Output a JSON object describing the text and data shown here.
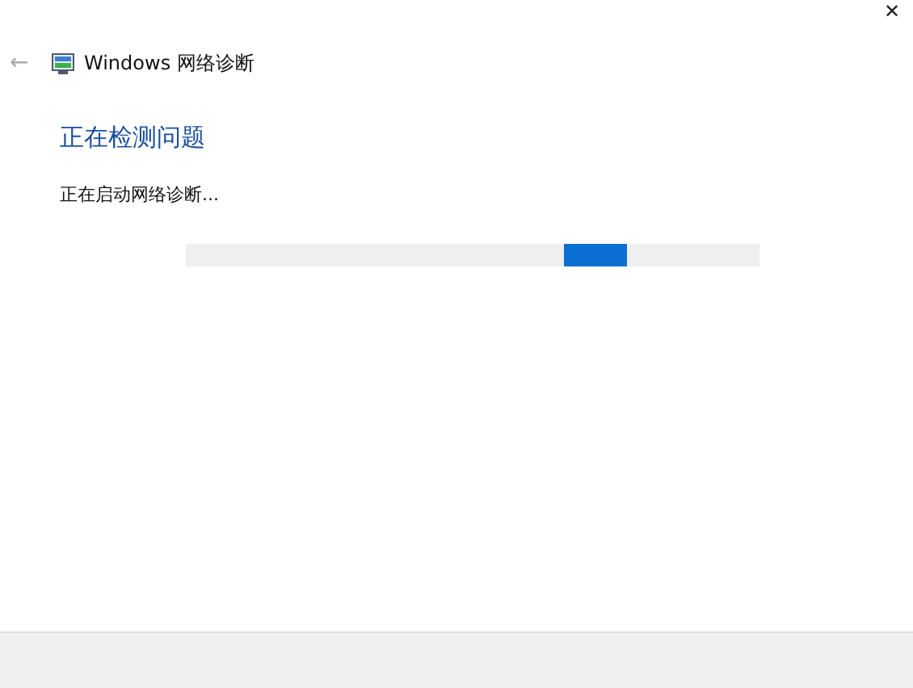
{
  "window": {
    "title": "Windows 网络诊断",
    "close": "✕",
    "back": "←"
  },
  "heading": "正在检测问题",
  "status": "正在启动网络诊断...",
  "progress": {
    "indeterminate": true
  }
}
